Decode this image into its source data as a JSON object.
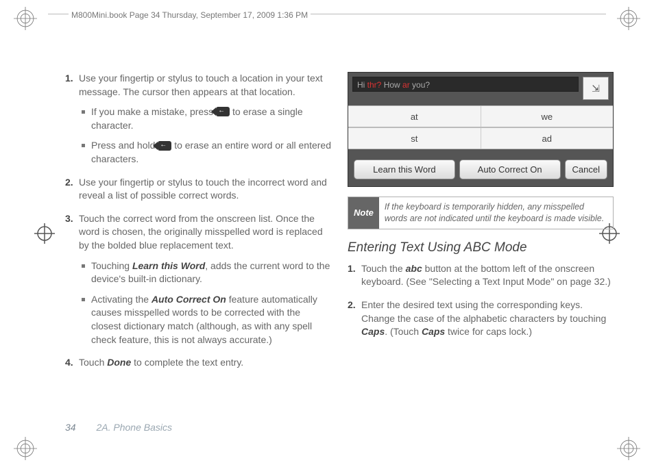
{
  "header": {
    "book_meta": "M800Mini.book  Page 34  Thursday, September 17, 2009  1:36 PM"
  },
  "left": {
    "step1_num": "1.",
    "step1_text": "Use your fingertip or stylus to touch a location in your text message. The cursor then appears at that location.",
    "step1_sub1_a": "If you make a mistake, press ",
    "step1_sub1_b": " to erase a single character.",
    "step1_sub2_a": "Press and hold ",
    "step1_sub2_b": " to erase an entire word or all entered characters.",
    "step2_num": "2.",
    "step2_text": "Use your fingertip or stylus to touch the incorrect word and reveal a list of possible correct words.",
    "step3_num": "3.",
    "step3_text": "Touch the correct word from the onscreen list. Once the word is chosen, the originally misspelled word is replaced by the bolded blue replacement text.",
    "step3_sub1_a": "Touching ",
    "step3_sub1_b": "Learn this Word",
    "step3_sub1_c": ", adds the current word to the device's built-in dictionary.",
    "step3_sub2_a": "Activating the ",
    "step3_sub2_b": "Auto Correct On",
    "step3_sub2_c": " feature automatically causes misspelled words to be corrected with the closest dictionary match (although, as with any spell check feature, this is not always accurate.)",
    "step4_num": "4.",
    "step4_a": "Touch ",
    "step4_b": "Done",
    "step4_c": " to complete the text entry."
  },
  "screenshot": {
    "field_hi": "Hi ",
    "field_err1": "thr?",
    "field_mid": " How ",
    "field_err2": "ar",
    "field_end": " you?",
    "sugg_r1_c1": "at",
    "sugg_r1_c2": "we",
    "sugg_r2_c1": "st",
    "sugg_r2_c2": "ad",
    "btn_learn": "Learn this Word",
    "btn_auto": "Auto Correct On",
    "btn_cancel": "Cancel"
  },
  "note": {
    "label": "Note",
    "text": "If the keyboard is temporarily hidden, any misspelled words are not indicated until the keyboard is made visible."
  },
  "right": {
    "heading": "Entering Text Using ABC Mode",
    "step1_num": "1.",
    "step1_a": "Touch the ",
    "step1_b": "abc",
    "step1_c": " button at the bottom left of the onscreen keyboard. (See \"Selecting a Text Input Mode\" on page 32.)",
    "step2_num": "2.",
    "step2_a": "Enter the desired text using the corresponding keys. Change the case of the alphabetic characters by touching ",
    "step2_b": "Caps",
    "step2_c": ". (Touch ",
    "step2_d": "Caps",
    "step2_e": " twice for caps lock.)"
  },
  "footer": {
    "page_num": "34",
    "section": "2A. Phone Basics"
  }
}
